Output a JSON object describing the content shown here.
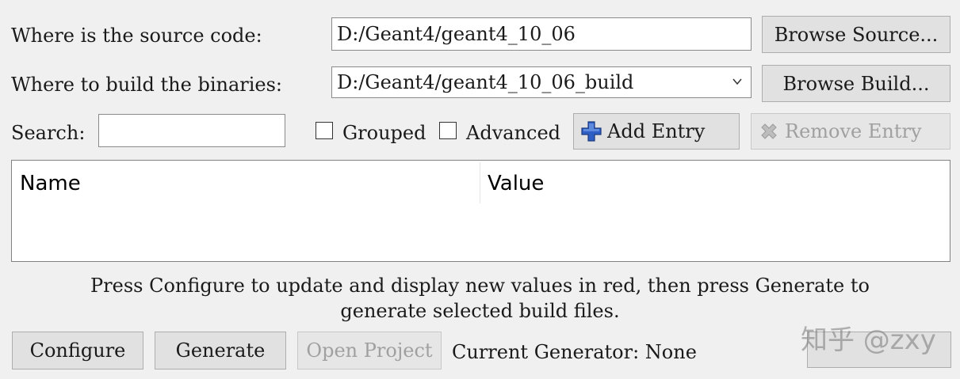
{
  "source": {
    "label": "Where is the source code:",
    "value": "D:/Geant4/geant4_10_06",
    "browse_label": "Browse Source..."
  },
  "build": {
    "label": "Where to build the binaries:",
    "value": "D:/Geant4/geant4_10_06_build",
    "browse_label": "Browse Build..."
  },
  "search": {
    "label": "Search:",
    "value": ""
  },
  "options": {
    "grouped_label": "Grouped",
    "grouped_checked": false,
    "advanced_label": "Advanced",
    "advanced_checked": false,
    "add_entry_label": "Add Entry",
    "remove_entry_label": "Remove Entry"
  },
  "table": {
    "columns": [
      "Name",
      "Value"
    ],
    "rows": []
  },
  "message": {
    "line1": "Press Configure to update and display new values in red, then press Generate to",
    "line2": "generate selected build files."
  },
  "bottom": {
    "configure_label": "Configure",
    "generate_label": "Generate",
    "open_project_label": "Open Project",
    "current_generator": "Current Generator: None"
  },
  "watermark": "知乎 @zxy"
}
